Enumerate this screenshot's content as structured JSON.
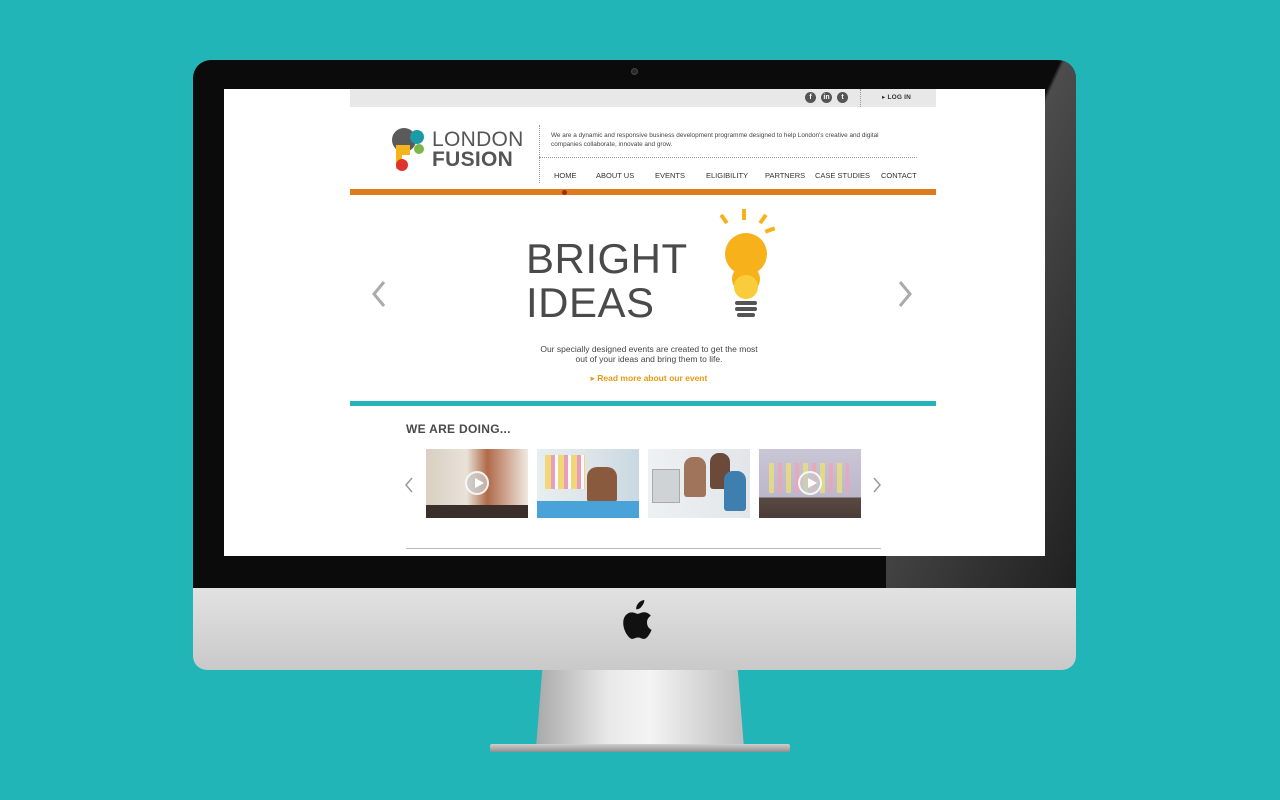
{
  "site": {
    "brand_line1": "LONDON",
    "brand_line2": "FUSION",
    "tagline": "We are a dynamic and responsive business development programme designed to help London's creative and digital companies collaborate, innovate and grow.",
    "login_label": "LOG IN"
  },
  "social": [
    {
      "icon": "facebook-icon",
      "glyph": "f"
    },
    {
      "icon": "linkedin-icon",
      "glyph": "in"
    },
    {
      "icon": "twitter-icon",
      "glyph": "t"
    }
  ],
  "nav": [
    "HOME",
    "ABOUT US",
    "EVENTS",
    "ELIGIBILITY",
    "PARTNERS",
    "CASE STUDIES",
    "CONTACT"
  ],
  "hero": {
    "title_line1": "BRIGHT",
    "title_line2": "IDEAS",
    "copy": "Our specially designed events are created to get the most out of your ideas and bring them to life.",
    "link": "Read more about our event"
  },
  "doing": {
    "title": "WE ARE DOING..."
  },
  "colors": {
    "background": "#22b5b7",
    "orange": "#e07a1e",
    "teal": "#24b3ba",
    "link": "#e89a10",
    "bulb": "#f7b21b"
  }
}
